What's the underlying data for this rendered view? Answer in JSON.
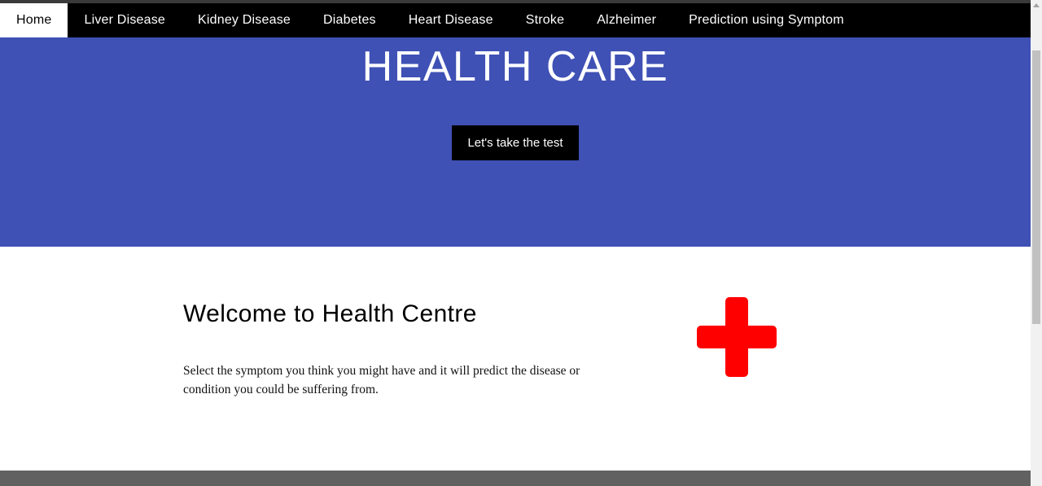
{
  "nav": {
    "items": [
      {
        "label": "Home",
        "active": true
      },
      {
        "label": "Liver Disease",
        "active": false
      },
      {
        "label": "Kidney Disease",
        "active": false
      },
      {
        "label": "Diabetes",
        "active": false
      },
      {
        "label": "Heart Disease",
        "active": false
      },
      {
        "label": "Stroke",
        "active": false
      },
      {
        "label": "Alzheimer",
        "active": false
      },
      {
        "label": "Prediction using Symptom",
        "active": false
      }
    ]
  },
  "hero": {
    "title": "HEALTH CARE",
    "button_label": "Let's take the test"
  },
  "welcome": {
    "title": "Welcome to Health Centre",
    "text": "Select the symptom you think you might have and it will predict the disease or condition you could be suffering from."
  },
  "icons": {
    "medical_cross": "medical-cross-icon"
  },
  "colors": {
    "nav_background": "#000000",
    "hero_background": "#3f51b5",
    "button_background": "#000000",
    "cross_color": "#ff0000",
    "footer_background": "#616161"
  }
}
